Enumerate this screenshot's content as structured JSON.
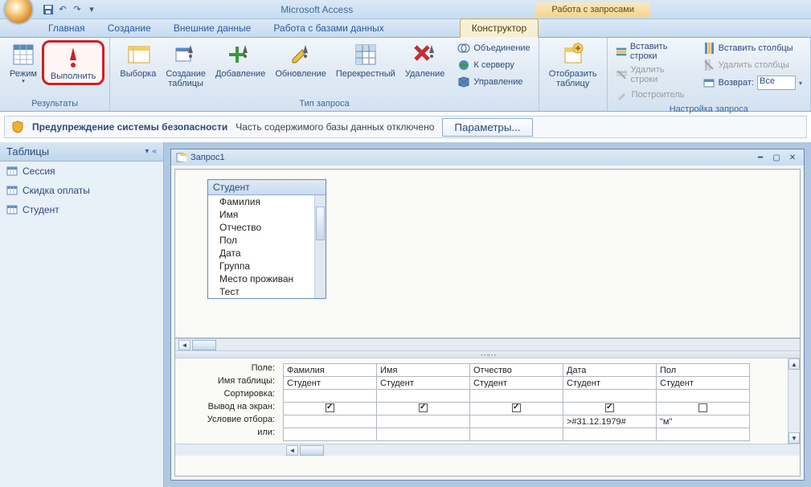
{
  "app_title": "Microsoft Access",
  "contextual_tab_title": "Работа с запросами",
  "tabs": {
    "home": "Главная",
    "create": "Создание",
    "external": "Внешние данные",
    "dbtools": "Работа с базами данных",
    "design": "Конструктор"
  },
  "ribbon": {
    "results": {
      "label": "Результаты",
      "view": "Режим",
      "run": "Выполнить"
    },
    "querytype": {
      "label": "Тип запроса",
      "select": "Выборка",
      "maketable1": "Создание",
      "maketable2": "таблицы",
      "append": "Добавление",
      "update": "Обновление",
      "crosstab": "Перекрестный",
      "delete": "Удаление",
      "union": "Объединение",
      "passthrough": "К серверу",
      "datadef": "Управление"
    },
    "showtable": {
      "show1": "Отобразить",
      "show2": "таблицу"
    },
    "querysetup": {
      "label": "Настройка запроса",
      "insertrows": "Вставить строки",
      "deleterows": "Удалить строки",
      "builder": "Построитель",
      "insertcols": "Вставить столбцы",
      "deletecols": "Удалить столбцы",
      "return": "Возврат:",
      "return_val": "Все"
    }
  },
  "security": {
    "title": "Предупреждение системы безопасности",
    "msg": "Часть содержимого базы данных отключено",
    "btn": "Параметры..."
  },
  "nav": {
    "header": "Таблицы",
    "items": [
      "Сессия",
      "Скидка оплаты",
      "Студент"
    ]
  },
  "query_window": {
    "title": "Запрос1",
    "table_name": "Студент",
    "fields": [
      "Фамилия",
      "Имя",
      "Отчество",
      "Пол",
      "Дата",
      "Группа",
      "Место проживан",
      "Тест"
    ]
  },
  "grid": {
    "labels": {
      "field": "Поле:",
      "table": "Имя таблицы:",
      "sort": "Сортировка:",
      "show": "Вывод на экран:",
      "criteria": "Условие отбора:",
      "or": "или:"
    },
    "columns": [
      {
        "field": "Фамилия",
        "table": "Студент",
        "show": true,
        "criteria": ""
      },
      {
        "field": "Имя",
        "table": "Студент",
        "show": true,
        "criteria": ""
      },
      {
        "field": "Отчество",
        "table": "Студент",
        "show": true,
        "criteria": ""
      },
      {
        "field": "Дата",
        "table": "Студент",
        "show": true,
        "criteria": ">#31.12.1979#"
      },
      {
        "field": "Пол",
        "table": "Студент",
        "show": false,
        "criteria": "\"м\""
      }
    ]
  }
}
